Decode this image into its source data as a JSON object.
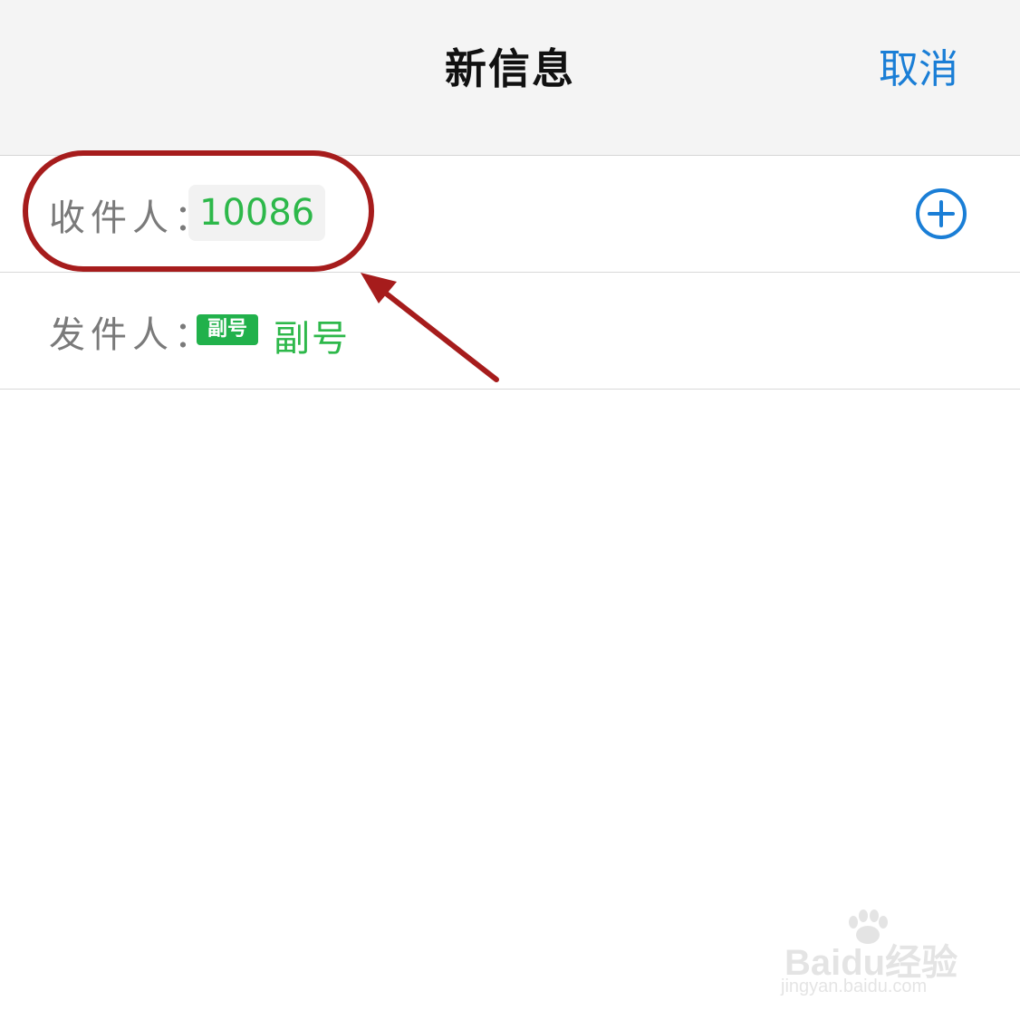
{
  "header": {
    "title": "新信息",
    "cancel_label": "取消"
  },
  "recipient_row": {
    "label": "收件人：",
    "recipient": "10086",
    "add_icon": "plus-circle-icon"
  },
  "sender_row": {
    "label": "发件人：",
    "badge": "副号",
    "sender": "副号"
  },
  "annotation": {
    "color": "#a61c1c"
  },
  "watermark": {
    "logo_text": "Baidu经验",
    "url": "jingyan.baidu.com"
  },
  "colors": {
    "accent_blue": "#1a7ed6",
    "green": "#2db84a",
    "badge_green": "#21b14b",
    "label_gray": "#7a7a7a"
  }
}
